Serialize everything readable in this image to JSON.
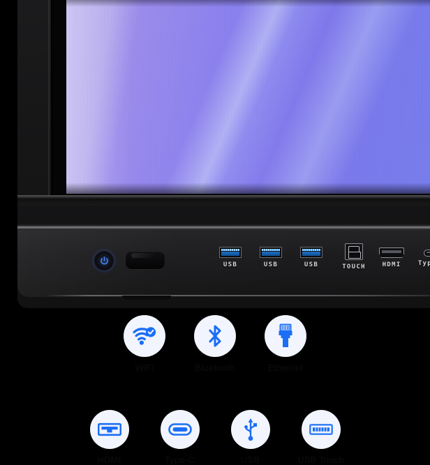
{
  "device": {
    "type": "interactive-flat-panel-display",
    "screen": {
      "wallpaper_description": "purple-blue gradient with diagonal light streaks",
      "colors": {
        "gradient_start": "#bdb0f2",
        "gradient_mid": "#8e84f2",
        "gradient_end": "#7b86f3",
        "streak": "#d6deff"
      }
    },
    "bezel_color": "#1c1c1e",
    "accent_blue": "#1b6ef5"
  },
  "front_panel": {
    "power_button": {
      "name": "Power",
      "icon": "power-icon",
      "glow_color": "#4a82ff"
    },
    "ir_sensor": {
      "name": "IR Sensor"
    },
    "ports": [
      {
        "label": "USB",
        "icon": "usb-a-port"
      },
      {
        "label": "USB",
        "icon": "usb-a-port"
      },
      {
        "label": "USB",
        "icon": "usb-a-port"
      },
      {
        "label": "TOUCH",
        "icon": "usb-b-port"
      },
      {
        "label": "HDMI",
        "icon": "hdmi-port"
      },
      {
        "label": "Type-C",
        "icon": "usb-c-port"
      }
    ]
  },
  "icon_grid": {
    "row1": [
      {
        "label": "WiFi",
        "icon": "wifi-check-icon",
        "color": "#1b6ef5"
      },
      {
        "label": "Bluetooth",
        "icon": "bluetooth-icon",
        "color": "#1b6ef5"
      },
      {
        "label": "Ethernet",
        "icon": "ethernet-plug-icon",
        "color": "#1b6ef5"
      }
    ],
    "row2": [
      {
        "label": "HDMI",
        "icon": "hdmi-connector-icon",
        "color": "#1b6ef5"
      },
      {
        "label": "Type-C",
        "icon": "usb-c-connector-icon",
        "color": "#1b6ef5"
      },
      {
        "label": "USB",
        "icon": "usb-trident-icon",
        "color": "#1b6ef5"
      },
      {
        "label": "USB Touch",
        "icon": "usb-a-connector-icon",
        "color": "#1b6ef5"
      }
    ]
  }
}
